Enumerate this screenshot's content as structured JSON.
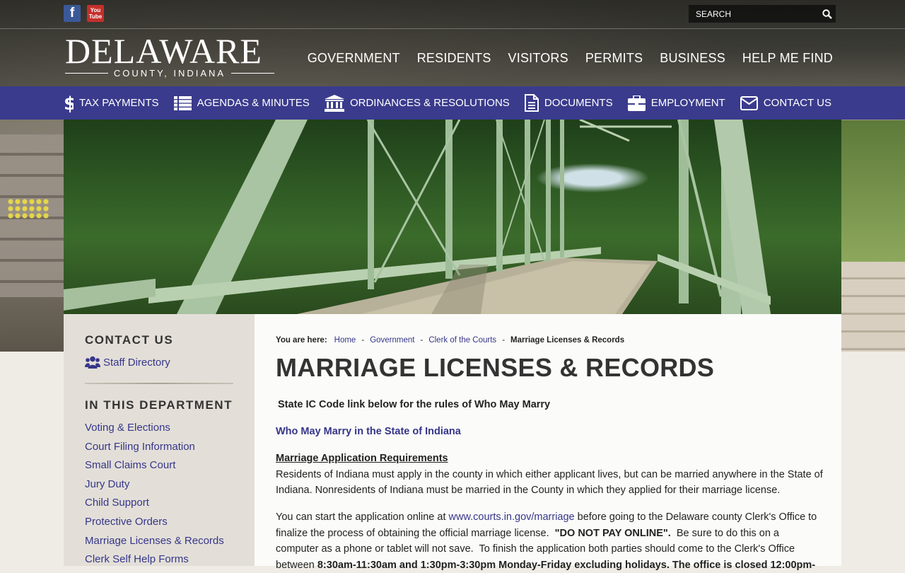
{
  "social": {
    "facebook_label": "f",
    "youtube_label": "You\nTube"
  },
  "search": {
    "placeholder": "SEARCH"
  },
  "logo": {
    "name": "DELAWARE",
    "subtitle": "COUNTY, INDIANA"
  },
  "main_nav": [
    "GOVERNMENT",
    "RESIDENTS",
    "VISITORS",
    "PERMITS",
    "BUSINESS",
    "HELP ME FIND"
  ],
  "quick_links": [
    {
      "label": "TAX PAYMENTS",
      "icon": "dollar-icon"
    },
    {
      "label": "AGENDAS & MINUTES",
      "icon": "list-icon"
    },
    {
      "label": "ORDINANCES & RESOLUTIONS",
      "icon": "courthouse-icon"
    },
    {
      "label": "DOCUMENTS",
      "icon": "document-icon"
    },
    {
      "label": "EMPLOYMENT",
      "icon": "briefcase-icon"
    },
    {
      "label": "CONTACT US",
      "icon": "envelope-icon"
    }
  ],
  "sidebar": {
    "contact_heading": "CONTACT US",
    "staff_directory": "Staff Directory",
    "dept_heading": "IN THIS DEPARTMENT",
    "items": [
      "Voting & Elections",
      "Court Filing Information",
      "Small Claims Court",
      "Jury Duty",
      "Child Support",
      "Protective Orders",
      "Marriage Licenses & Records",
      "Clerk Self Help Forms"
    ]
  },
  "breadcrumb": {
    "label": "You are here:",
    "links": [
      "Home",
      "Government",
      "Clerk of the Courts"
    ],
    "separator": "-",
    "current": "Marriage Licenses & Records"
  },
  "page": {
    "title": "MARRIAGE LICENSES & RECORDS",
    "intro": "State IC Code link below for the rules of Who May Marry",
    "who_may_marry_link": "Who May Marry in the State of Indiana",
    "requirements_heading": "Marriage Application Requirements",
    "requirements_text": "Residents of Indiana must apply in the county in which either applicant lives, but can be married anywhere in the State of Indiana.  Nonresidents of Indiana must be married in the County in which they applied for their marriage license.",
    "online_pre": "You can start the application online at ",
    "online_link": "www.courts.in.gov/marriage",
    "online_mid": " before going to the Delaware county Clerk's Office to finalize the process of obtaining the official marriage license.  ",
    "do_not_pay": "\"DO NOT PAY ONLINE\".",
    "online_post": "  Be sure to do this on a computer as a phone or tablet will not save.  To finish the application both parties should come to the Clerk's Office between ",
    "hours": "8:30am-11:30am and 1:30pm-3:30pm Monday-Friday excluding holidays.  The office is closed 12:00pm-"
  },
  "colors": {
    "quickbar": "#3a3b8c",
    "link": "#36368a",
    "sidebar_bg": "#e3dfd8"
  }
}
